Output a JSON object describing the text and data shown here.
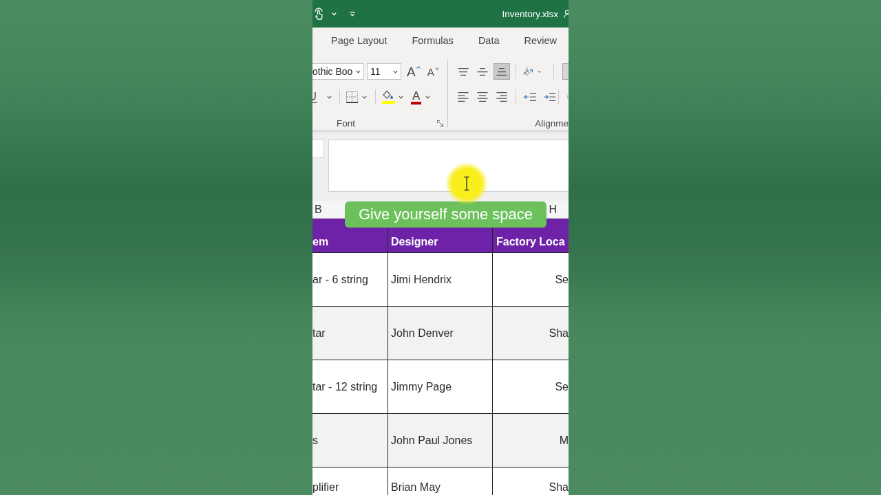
{
  "window": {
    "title": "Inventory.xlsx"
  },
  "ribbon_tabs": [
    {
      "label": "Page Layout",
      "selected": false
    },
    {
      "label": "Formulas",
      "selected": false
    },
    {
      "label": "Data",
      "selected": false
    },
    {
      "label": "Review",
      "selected": false
    }
  ],
  "font_group": {
    "font_name": "othic Boo",
    "font_size": "11",
    "grow_font": "A",
    "shrink_font": "A",
    "font_color": "A",
    "label": "Font"
  },
  "alignment_group": {
    "vertical": [
      {
        "kind": "top",
        "selected": false
      },
      {
        "kind": "middle",
        "selected": false
      },
      {
        "kind": "bottom",
        "selected": true
      }
    ],
    "horizontal": [
      {
        "kind": "left",
        "selected": false
      },
      {
        "kind": "center",
        "selected": false
      },
      {
        "kind": "right",
        "selected": false
      }
    ],
    "label": "Alignme"
  },
  "sheet": {
    "columns": [
      {
        "letter": "B",
        "heading": "em"
      },
      {
        "heading": "Designer"
      },
      {
        "letter": "H",
        "heading": "Factory Loca"
      }
    ],
    "rows": [
      [
        "ar - 6 string",
        "Jimi Hendrix",
        "Se"
      ],
      [
        "tar",
        "John Denver",
        "Sha"
      ],
      [
        "tar - 12 string",
        "Jimmy Page",
        "Se"
      ],
      [
        "s",
        "John Paul Jones",
        "M"
      ],
      [
        "plifier",
        "Brian May",
        "Sha"
      ]
    ]
  },
  "caption": "Give yourself some space"
}
